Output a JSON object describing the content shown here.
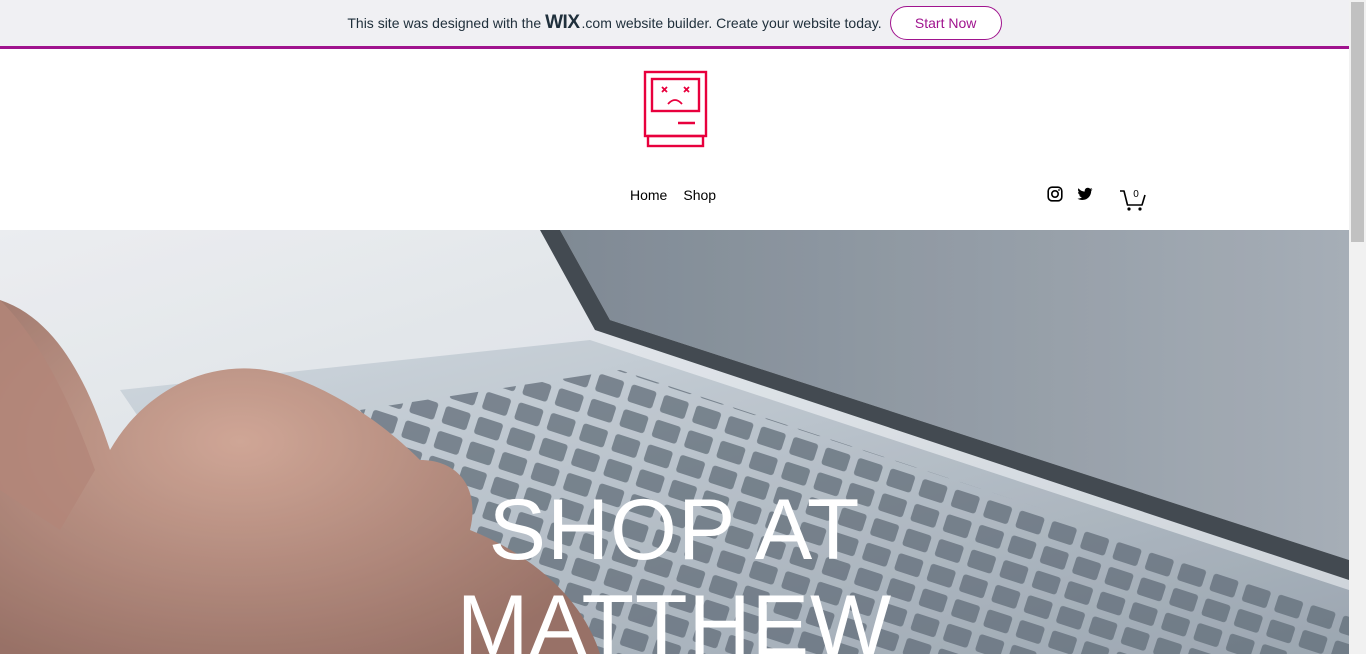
{
  "banner": {
    "text_before": "This site was designed with the",
    "wix": "WIX",
    "text_after": ".com website builder. Create your website today.",
    "cta_label": "Start Now",
    "accent": "#a0138e"
  },
  "header": {
    "logo_icon": "sad-computer-icon",
    "logo_color": "#e8003d",
    "nav": [
      {
        "label": "Home"
      },
      {
        "label": "Shop"
      }
    ],
    "social": [
      "instagram-icon",
      "twitter-icon"
    ],
    "cart": {
      "icon": "cart-icon",
      "count": "0"
    }
  },
  "hero": {
    "title_line1": "SHOP AT",
    "title_line2": "MATTHEW"
  }
}
